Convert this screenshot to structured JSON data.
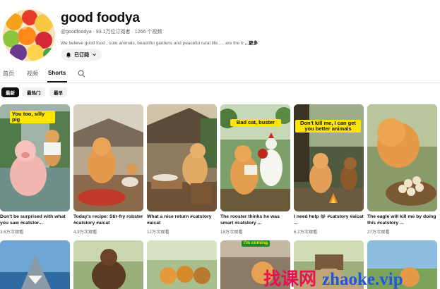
{
  "channel": {
    "name": "good foodya",
    "meta": "@goodfoodya · 93.1万位订阅者 · 1266 个视频",
    "description": "We believe good food , cute animals, beautiful gardens and peaceful rural life..... are the b",
    "more": "...更多",
    "subscribed_label": "已订阅"
  },
  "tabs": [
    {
      "label": "首页",
      "active": false
    },
    {
      "label": "视频",
      "active": false
    },
    {
      "label": "Shorts",
      "active": true
    }
  ],
  "chips": [
    {
      "label": "最新",
      "active": true
    },
    {
      "label": "最热门",
      "active": false
    },
    {
      "label": "最早",
      "active": false
    }
  ],
  "videos": [
    {
      "caption": "You too, silly pig",
      "title": "Don't be surprised with what you saw #catstor...",
      "views": "3.6万次观看"
    },
    {
      "caption": "",
      "title": "Today's recipe: Stir-fry robster #catstory #aicat",
      "views": "4.9万次观看"
    },
    {
      "caption": "",
      "title": "What a nice return #catstory #aicat",
      "views": "12万次观看"
    },
    {
      "caption": "Bad cat, buster",
      "title": "The rooster thinks he was smart #catstory ...",
      "views": "18万次观看"
    },
    {
      "caption": "Don't kill me, I can get you better animals",
      "title": "I need help 😂 #catstory #aicat ...",
      "views": "6.2万次观看"
    },
    {
      "caption": "",
      "title": "The eagle will kill me by doing this #catstory ...",
      "views": "27万次观看"
    }
  ],
  "row2_caption": "I'm coming",
  "watermark": {
    "part1": "找课网",
    "part2": "zhaoke.vip"
  },
  "colors": {
    "accent_text": "#0f0f0f",
    "secondary_text": "#606060",
    "chip_bg": "#f2f2f2",
    "caption_bg": "#ffe500",
    "watermark_red": "#e8104f",
    "watermark_blue": "#1f58d8"
  }
}
